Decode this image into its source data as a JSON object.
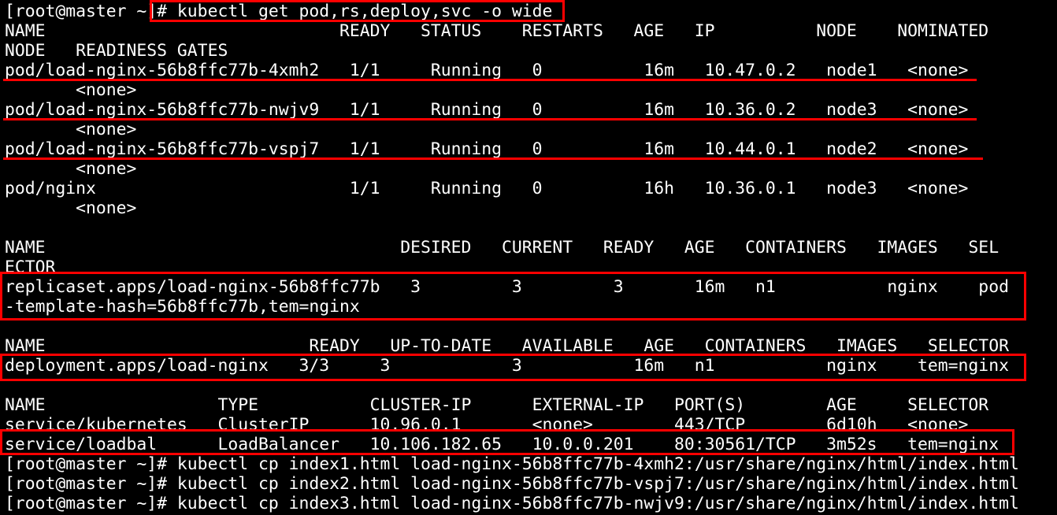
{
  "terminal": {
    "lines": [
      "[root@master ~]# kubectl get pod,rs,deploy,svc -o wide",
      "NAME                             READY   STATUS    RESTARTS   AGE   IP          NODE    NOMINATED",
      "NODE   READINESS GATES",
      "pod/load-nginx-56b8ffc77b-4xmh2   1/1     Running   0          16m   10.47.0.2   node1   <none>",
      "       <none>",
      "pod/load-nginx-56b8ffc77b-nwjv9   1/1     Running   0          16m   10.36.0.2   node3   <none>",
      "       <none>",
      "pod/load-nginx-56b8ffc77b-vspj7   1/1     Running   0          16m   10.44.0.1   node2   <none>",
      "       <none>",
      "pod/nginx                         1/1     Running   0          16h   10.36.0.1   node3   <none>",
      "       <none>",
      "",
      "NAME                                   DESIRED   CURRENT   READY   AGE   CONTAINERS   IMAGES   SEL",
      "ECTOR",
      "replicaset.apps/load-nginx-56b8ffc77b   3         3         3       16m   n1           nginx    pod",
      "-template-hash=56b8ffc77b,tem=nginx",
      "",
      "NAME                          READY   UP-TO-DATE   AVAILABLE   AGE   CONTAINERS   IMAGES   SELECTOR",
      "deployment.apps/load-nginx   3/3     3            3           16m   n1           nginx    tem=nginx",
      "",
      "NAME                 TYPE           CLUSTER-IP      EXTERNAL-IP   PORT(S)        AGE     SELECTOR",
      "service/kubernetes   ClusterIP      10.96.0.1       <none>        443/TCP        6d10h   <none>",
      "service/loadbal      LoadBalancer   10.106.182.65   10.0.0.201    80:30561/TCP   3m52s   tem=nginx",
      "[root@master ~]# kubectl cp index1.html load-nginx-56b8ffc77b-4xmh2:/usr/share/nginx/html/index.html",
      "[root@master ~]# kubectl cp index2.html load-nginx-56b8ffc77b-vspj7:/usr/share/nginx/html/index.html",
      "[root@master ~]# kubectl cp index3.html load-nginx-56b8ffc77b-nwjv9:/usr/share/nginx/html/index.html"
    ]
  },
  "annotations": {
    "color": "#ff0000"
  },
  "colors": {
    "background": "#000000",
    "foreground": "#ffffff",
    "annotation": "#ff0000"
  }
}
